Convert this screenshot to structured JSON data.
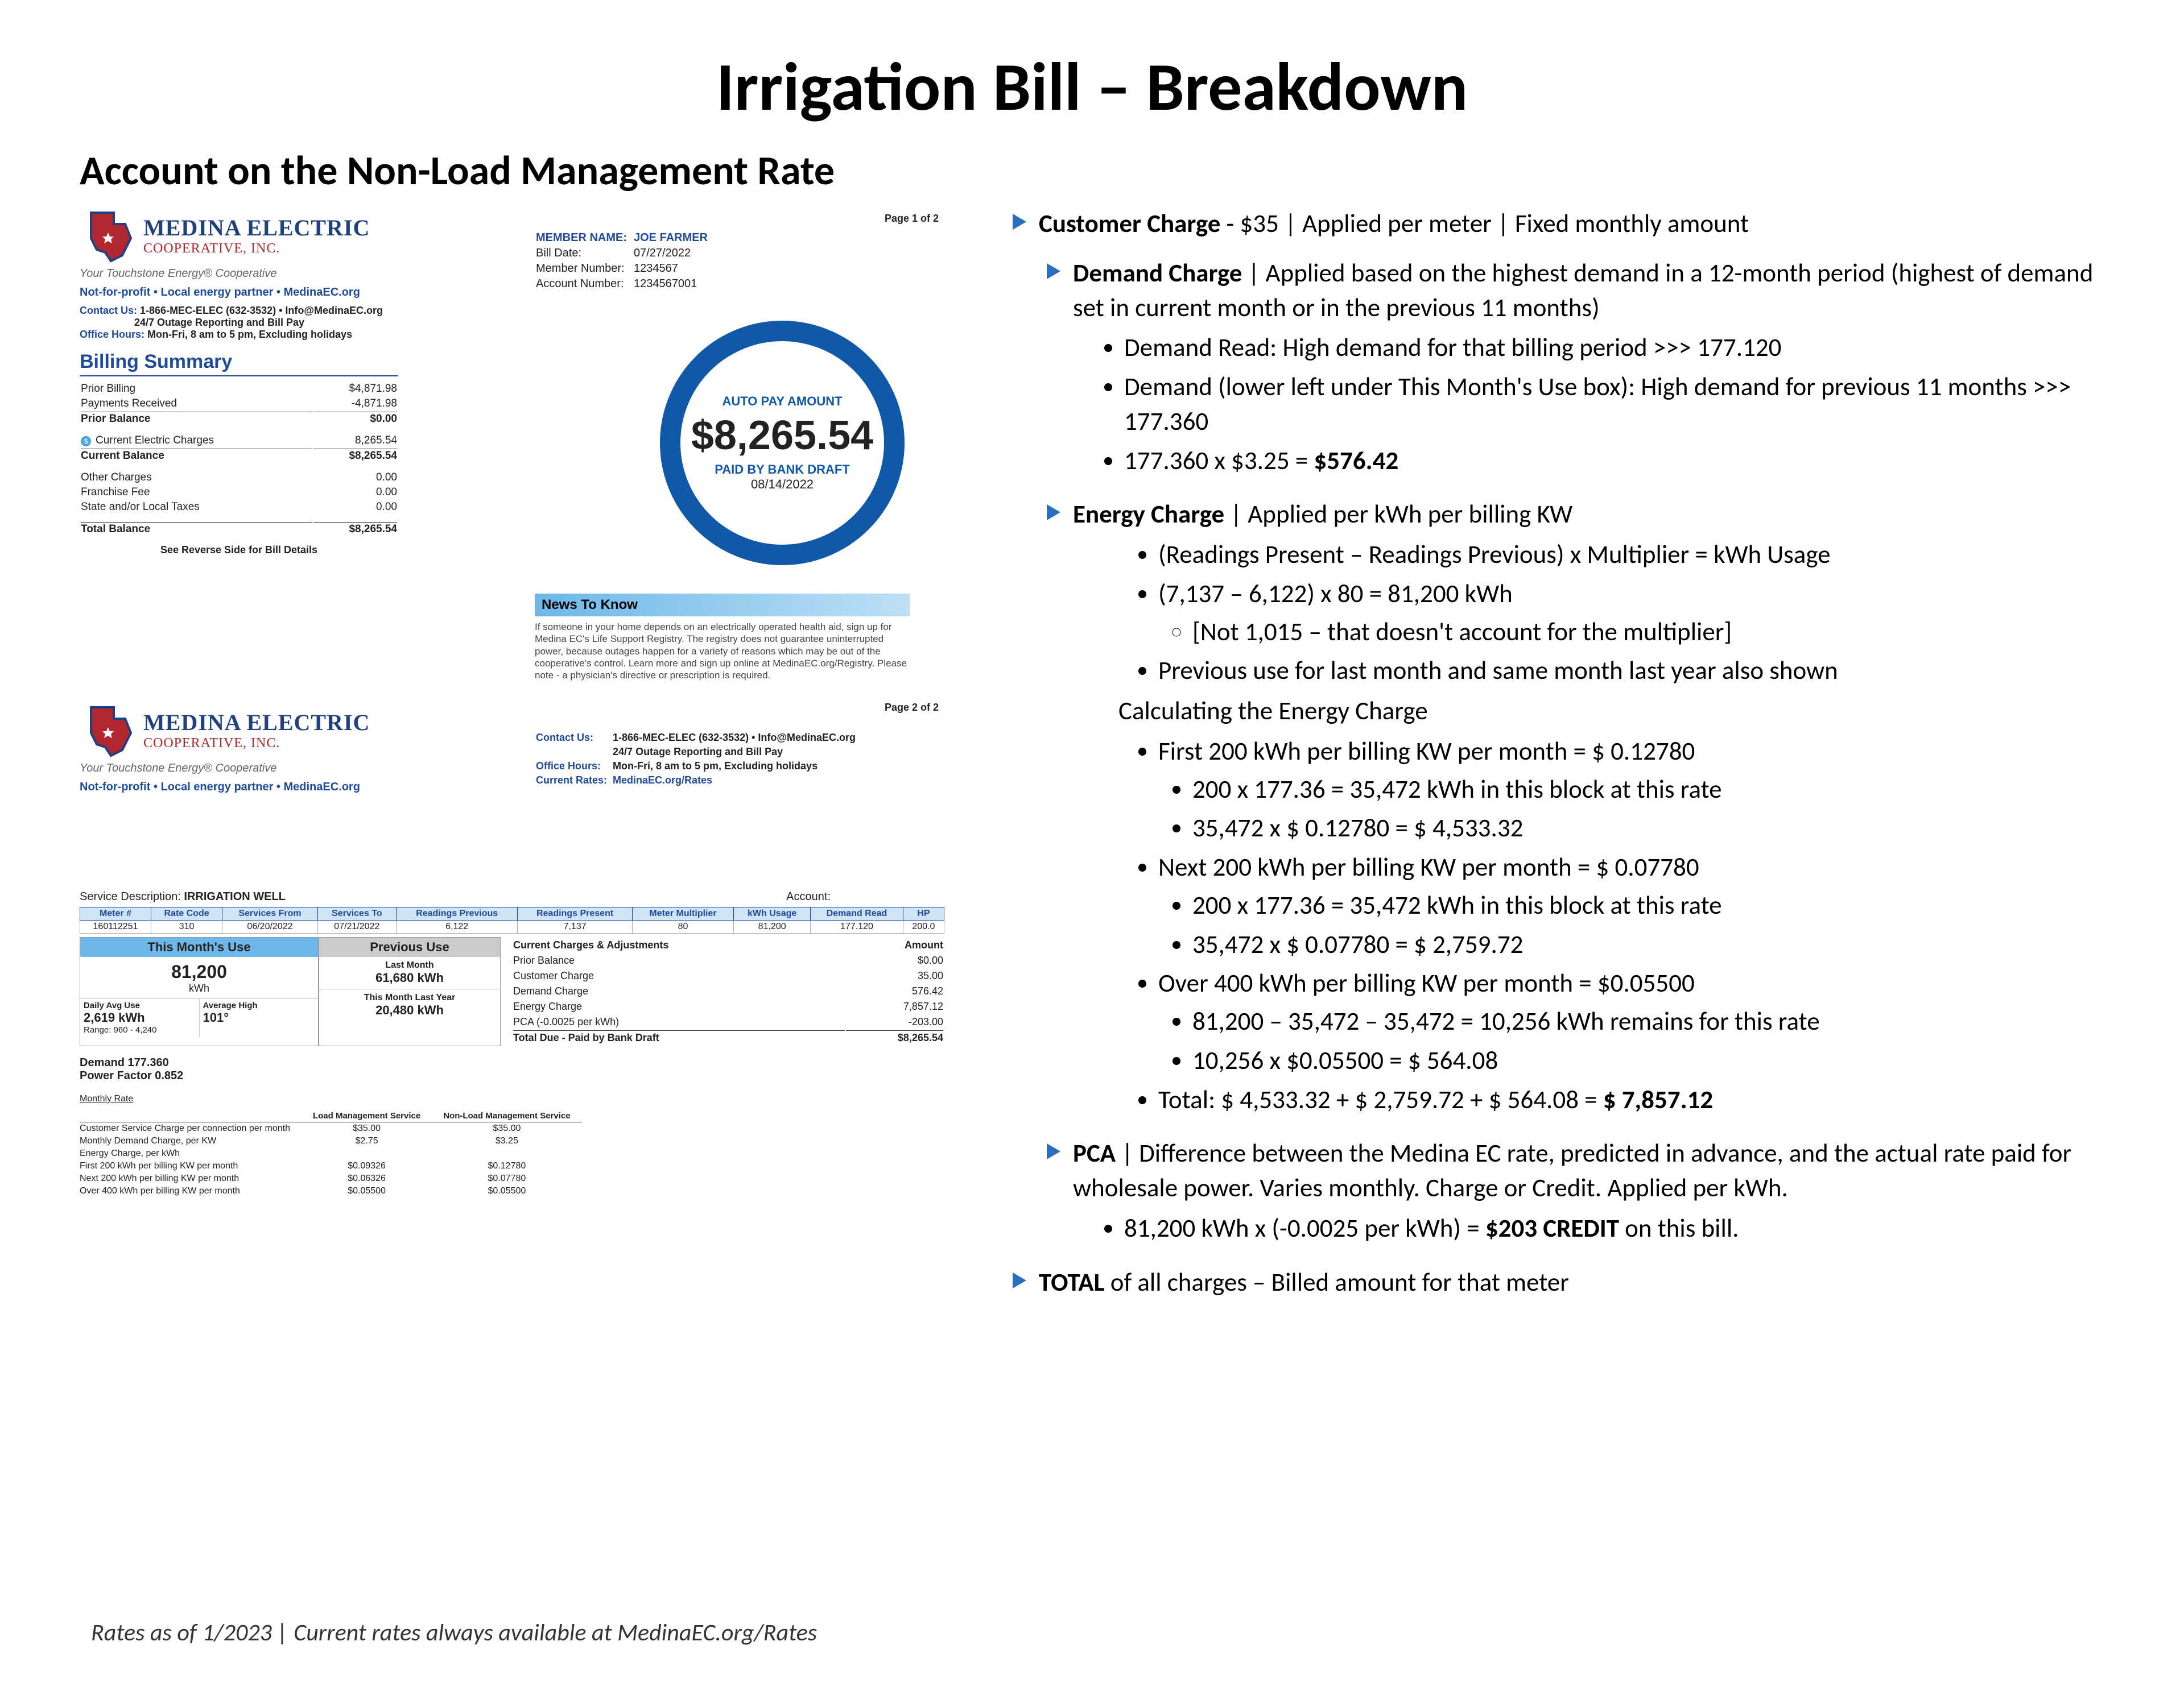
{
  "title": "Irrigation Bill – Breakdown",
  "subtitle": "Account on the Non-Load Management Rate",
  "footer": "Rates as of 1/2023    |    Current rates always available at MedinaEC.org/Rates",
  "logo": {
    "l1": "MEDINA ELECTRIC",
    "l2": "COOPERATIVE, INC.",
    "tagline": "Your Touchstone Energy® Cooperative"
  },
  "nfp": "Not-for-profit • Local energy partner • MedinaEC.org",
  "contact": {
    "contact_label": "Contact Us:",
    "contact_val": "1-866-MEC-ELEC (632-3532) • Info@MedinaEC.org",
    "contact_val2": "24/7 Outage Reporting and Bill Pay",
    "office_label": "Office Hours:",
    "office_val": "Mon-Fri, 8 am to 5 pm, Excluding holidays",
    "rates_label": "Current Rates:",
    "rates_val": "MedinaEC.org/Rates"
  },
  "page1_no": "Page 1 of 2",
  "page2_no": "Page 2 of 2",
  "member": {
    "name_label": "MEMBER NAME:",
    "name": "JOE FARMER",
    "billdate_label": "Bill Date:",
    "billdate": "07/27/2022",
    "memno_label": "Member Number:",
    "memno": "1234567",
    "acctno_label": "Account Number:",
    "acctno": "1234567001"
  },
  "autopay": {
    "l1": "AUTO PAY AMOUNT",
    "amount": "$8,265.54",
    "l3": "PAID BY BANK DRAFT",
    "date": "08/14/2022"
  },
  "billing_summary_hdr": "Billing Summary",
  "billing_summary": [
    {
      "label": "Prior Billing",
      "val": "$4,871.98"
    },
    {
      "label": "Payments Received",
      "val": "-4,871.98"
    },
    {
      "label": "Prior Balance",
      "val": "$0.00",
      "bold": true,
      "rule": true
    },
    {
      "label": "Current Electric Charges",
      "val": "8,265.54",
      "icon": true,
      "spacer": true
    },
    {
      "label": "Current Balance",
      "val": "$8,265.54",
      "bold": true,
      "rule": true
    },
    {
      "label": "Other Charges",
      "val": "0.00",
      "spacer": true
    },
    {
      "label": "Franchise Fee",
      "val": "0.00"
    },
    {
      "label": "State and/or Local Taxes",
      "val": "0.00"
    },
    {
      "label": "Total Balance",
      "val": "$8,265.54",
      "bold": true,
      "rule": true,
      "spacer": true
    }
  ],
  "reverse_note": "See Reverse Side for Bill Details",
  "news": {
    "hdr": "News To Know",
    "body": "If someone in your home depends on an electrically operated health aid, sign up for Medina EC's Life Support Registry. The registry does not guarantee uninterrupted power, because outages happen for a variety of reasons which may be out of the cooperative's control. Learn more and sign up online at MedinaEC.org/Registry. Please note - a physician's directive or prescription is required."
  },
  "serv_desc_label": "Service Description:",
  "serv_desc": "IRRIGATION WELL",
  "acct_label": "Account:",
  "meter_hdrs": [
    "Meter #",
    "Rate Code",
    "Services From",
    "Services To",
    "Readings Previous",
    "Readings Present",
    "Meter Multiplier",
    "kWh Usage",
    "Demand Read",
    "HP"
  ],
  "meter_row": [
    "160112251",
    "310",
    "06/20/2022",
    "07/21/2022",
    "6,122",
    "7,137",
    "80",
    "81,200",
    "177.120",
    "200.0"
  ],
  "this_month_hdr": "This Month's Use",
  "this_month_val": "81,200",
  "kwh": "kWh",
  "prev_hdr": "Previous Use",
  "last_month_label": "Last Month",
  "last_month_val": "61,680 kWh",
  "tmly_label": "This Month Last Year",
  "tmly_val": "20,480 kWh",
  "daily_label": "Daily Avg Use",
  "daily_val": "2,619 kWh",
  "range_label": "Range: 960 - 4,240",
  "avg_high_label": "Average High",
  "avg_high_val": "101°",
  "charges_hdr": "Current Charges & Adjustments",
  "amount_hdr": "Amount",
  "charges": [
    {
      "label": "Prior Balance",
      "val": "$0.00"
    },
    {
      "label": "Customer Charge",
      "val": "35.00"
    },
    {
      "label": "Demand Charge",
      "val": "576.42"
    },
    {
      "label": "Energy Charge",
      "val": "7,857.12"
    },
    {
      "label": "PCA (-0.0025 per kWh)",
      "val": "-203.00"
    }
  ],
  "charges_total": {
    "label": "Total Due - Paid by Bank Draft",
    "val": "$8,265.54"
  },
  "demand_line": "Demand 177.360",
  "pf_line": "Power Factor 0.852",
  "monthly_rate_hdr": "Monthly Rate",
  "rate_cols": [
    "Load Management Service",
    "Non-Load Management Service"
  ],
  "rate_rows": [
    {
      "label": "Customer Service Charge per connection per month",
      "v1": "$35.00",
      "v2": "$35.00"
    },
    {
      "label": "Monthly Demand Charge, per KW",
      "v1": "$2.75",
      "v2": "$3.25"
    },
    {
      "label": "Energy Charge, per kWh",
      "v1": "",
      "v2": ""
    },
    {
      "label": "First      200   kWh per billing KW per month",
      "v1": "$0.09326",
      "v2": "$0.12780"
    },
    {
      "label": "Next      200   kWh per billing KW per month",
      "v1": "$0.06326",
      "v2": "$0.07780"
    },
    {
      "label": "Over      400   kWh per billing KW per month",
      "v1": "$0.05500",
      "v2": "$0.05500"
    }
  ],
  "anno": {
    "cust": {
      "t": "Customer Charge",
      "r": " - $35    |    Applied per meter    |    Fixed monthly amount"
    },
    "demand": {
      "t": "Demand Charge",
      "r": "    |    Applied based on the highest demand in a 12-month period (highest of demand set in current month or in the previous 11 months)",
      "b1": "Demand Read: High demand for that billing period  >>>  177.120",
      "b2": "Demand (lower left under This Month's Use box): High demand for previous 11 months  >>>  177.360",
      "b3a": "177.360 x $3.25 = ",
      "b3b": "$576.42"
    },
    "energy": {
      "t": "Energy Charge",
      "r": "    |    Applied per kWh per billing KW",
      "b1": "(Readings Present – Readings Previous) x Multiplier = kWh Usage",
      "b2": "(7,137 – 6,122) x 80 = 81,200 kWh",
      "b2s": "[Not 1,015 – that doesn't account for the multiplier]",
      "b3": "Previous use for last month and same month last year also shown",
      "calc_hdr": "Calculating the Energy Charge",
      "c1": "First 200 kWh per billing KW per month = $ 0.12780",
      "c1a": "200 x 177.36 = 35,472 kWh in this block at this rate",
      "c1b": "35,472 x  $ 0.12780  =  $ 4,533.32",
      "c2": "Next 200 kWh per billing KW per month = $ 0.07780",
      "c2a": "200 x 177.36 = 35,472 kWh in this block at this rate",
      "c2b": "35,472 x  $ 0.07780 =  $ 2,759.72",
      "c3": "Over 400 kWh per billing KW per month =  $0.05500",
      "c3a": "81,200 – 35,472 – 35,472 = 10,256 kWh remains for this rate",
      "c3b": "10,256 x $0.05500 = $ 564.08",
      "tot_a": "Total: $ 4,533.32 + $ 2,759.72 + $ 564.08 = ",
      "tot_b": "$ 7,857.12"
    },
    "pca": {
      "t": "PCA",
      "r": "    |    Difference between the Medina EC rate, predicted in advance, and the actual rate paid for wholesale power. Varies monthly. Charge or Credit. Applied per kWh.",
      "b1a": "81,200 kWh x (-0.0025 per kWh) = ",
      "b1b": "$203 CREDIT",
      "b1c": " on this bill."
    },
    "total": {
      "t": "TOTAL",
      "r": " of all charges – Billed amount for that meter"
    }
  }
}
